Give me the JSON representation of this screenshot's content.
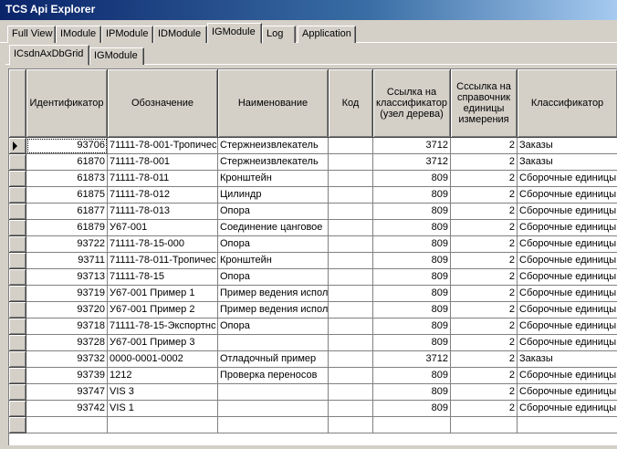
{
  "window": {
    "title": "TCS Api Explorer"
  },
  "tabs": [
    {
      "label": "Full View"
    },
    {
      "label": "IModule"
    },
    {
      "label": "IPModule"
    },
    {
      "label": "IDModule"
    },
    {
      "label": "IGModule"
    },
    {
      "label": "Log"
    },
    {
      "label": "Application"
    }
  ],
  "subtabs": [
    {
      "label": "ICsdnAxDbGrid"
    },
    {
      "label": "IGModule"
    }
  ],
  "grid": {
    "headers": [
      "Идентификатор",
      "Обозначение",
      "Наименование",
      "Код",
      "Ссылка на классификатор (узел дерева)",
      "Сссылка на справочник единицы измерения",
      "Классификатор"
    ],
    "rows": [
      [
        "93706",
        "71111-78-001-Тропичес",
        "Стержнеизвлекатель",
        "",
        "3712",
        "2",
        "Заказы"
      ],
      [
        "61870",
        "71111-78-001",
        "Стержнеизвлекатель",
        "",
        "3712",
        "2",
        "Заказы"
      ],
      [
        "61873",
        "71111-78-011",
        "Кронштейн",
        "",
        "809",
        "2",
        "Сборочные единицы"
      ],
      [
        "61875",
        "71111-78-012",
        "Цилиндр",
        "",
        "809",
        "2",
        "Сборочные единицы"
      ],
      [
        "61877",
        "71111-78-013",
        "Опора",
        "",
        "809",
        "2",
        "Сборочные единицы"
      ],
      [
        "61879",
        "У67-001",
        "Соединение цанговое",
        "",
        "809",
        "2",
        "Сборочные единицы"
      ],
      [
        "93722",
        "71111-78-15-000",
        "Опора",
        "",
        "809",
        "2",
        "Сборочные единицы"
      ],
      [
        "93711",
        "71111-78-011-Тропичес",
        "Кронштейн",
        "",
        "809",
        "2",
        "Сборочные единицы"
      ],
      [
        "93713",
        "71111-78-15",
        "Опора",
        "",
        "809",
        "2",
        "Сборочные единицы"
      ],
      [
        "93719",
        "У67-001 Пример 1",
        "Пример ведения испол",
        "",
        "809",
        "2",
        "Сборочные единицы"
      ],
      [
        "93720",
        "У67-001 Пример 2",
        "Пример ведения испол",
        "",
        "809",
        "2",
        "Сборочные единицы"
      ],
      [
        "93718",
        "71111-78-15-Экспортнс",
        "Опора",
        "",
        "809",
        "2",
        "Сборочные единицы"
      ],
      [
        "93728",
        "У67-001 Пример 3",
        "",
        "",
        "809",
        "2",
        "Сборочные единицы"
      ],
      [
        "93732",
        "0000-0001-0002",
        "Отладочный пример",
        "",
        "3712",
        "2",
        "Заказы"
      ],
      [
        "93739",
        "1212",
        "Проверка переносов",
        "",
        "809",
        "2",
        "Сборочные единицы"
      ],
      [
        "93747",
        "VIS 3",
        "",
        "",
        "809",
        "2",
        "Сборочные единицы"
      ],
      [
        "93742",
        "VIS 1",
        "",
        "",
        "809",
        "2",
        "Сборочные единицы"
      ],
      [
        "",
        "",
        "",
        "",
        "",
        "",
        ""
      ]
    ]
  }
}
